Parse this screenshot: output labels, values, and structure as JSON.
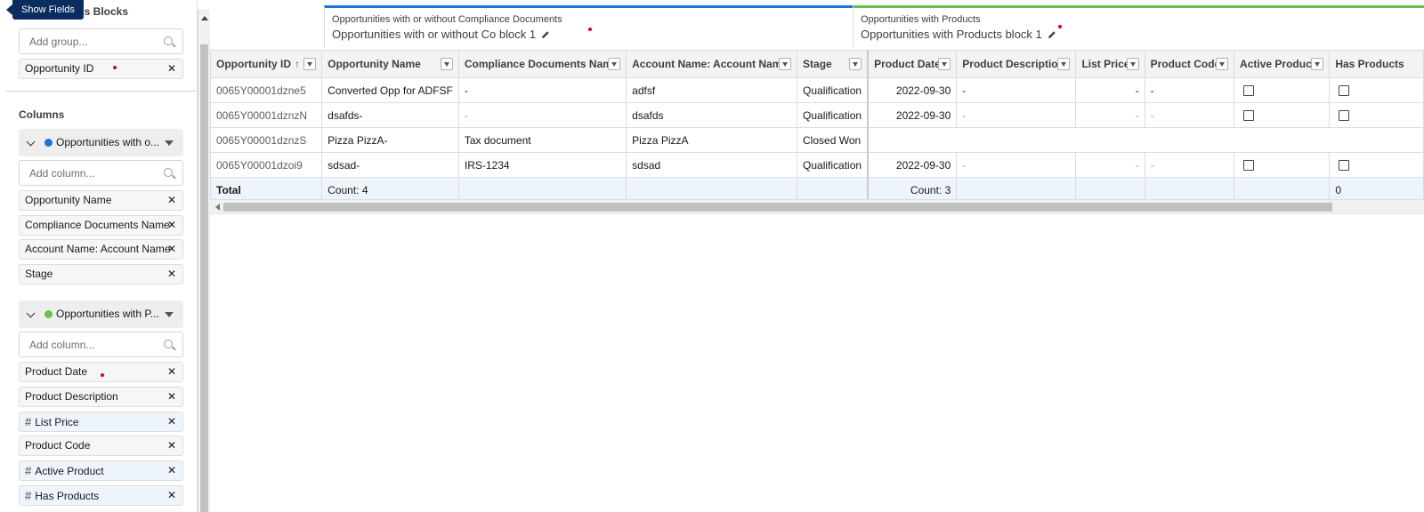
{
  "tooltip": "Show Fields",
  "left": {
    "blocks_title": "ss Blocks",
    "group_placeholder": "Add group...",
    "group_pill": "Opportunity ID",
    "columns_title": "Columns",
    "groups": [
      {
        "label": "Opportunities with o...",
        "color": "#1b74d3",
        "placeholder": "Add column...",
        "fields": [
          "Opportunity Name",
          "Compliance Documents Name",
          "Account Name: Account Name",
          "Stage"
        ]
      },
      {
        "label": "Opportunities with P...",
        "color": "#6abf4b",
        "placeholder": "Add column...",
        "fields": [
          "Product Date",
          "Product Description",
          "List Price",
          "Product Code",
          "Active Product",
          "Has Products"
        ]
      }
    ],
    "hash": "#"
  },
  "blocks": [
    {
      "subtitle": "Opportunities with or without Compliance Documents",
      "title": "Opportunities with or without Co block 1",
      "color": "#1b74d3"
    },
    {
      "subtitle": "Opportunities with Products",
      "title": "Opportunities with Products block 1",
      "color": "#6abf4b"
    }
  ],
  "columns": [
    "Opportunity ID",
    "Opportunity Name",
    "Compliance Documents Name",
    "Account Name: Account Name",
    "Stage",
    "Product Date",
    "Product Description",
    "List Price",
    "Product Code",
    "Active Product",
    "Has Products"
  ],
  "sort_glyph": "↑",
  "rows": [
    {
      "id": "0065Y00001dzne5",
      "name": "Converted Opp for ADFSF",
      "comp": "-",
      "acct": "adfsf",
      "stage": "Qualification",
      "pdate": "2022-09-30",
      "pdesc": "-",
      "price": "-",
      "code": "-"
    },
    {
      "id": "0065Y00001dznzN",
      "name": "dsafds-",
      "comp": "-",
      "acct": "dsafds",
      "stage": "Qualification",
      "pdate": "2022-09-30",
      "pdesc": "-",
      "price": "-",
      "code": "-"
    },
    {
      "id": "0065Y00001dznzS",
      "name": "Pizza PizzA-",
      "comp": "Tax document",
      "acct": "Pizza PizzA",
      "stage": "Closed Won",
      "pdate": "",
      "pdesc": "",
      "price": "",
      "code": ""
    },
    {
      "id": "0065Y00001dzoi9",
      "name": "sdsad-",
      "comp": "IRS-1234",
      "acct": "sdsad",
      "stage": "Qualification",
      "pdate": "2022-09-30",
      "pdesc": "-",
      "price": "-",
      "code": "-"
    }
  ],
  "total": {
    "label": "Total",
    "count1": "Count: 4",
    "count2": "Count: 3",
    "has_products": "0"
  }
}
